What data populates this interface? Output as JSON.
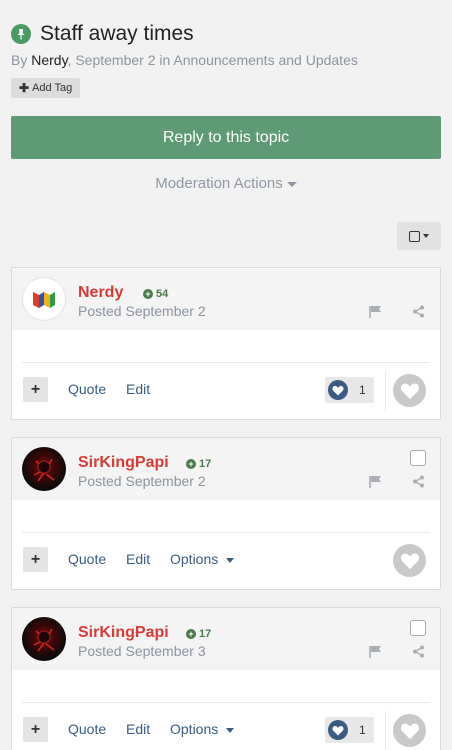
{
  "topic": {
    "title": "Staff away times",
    "byline_prefix": "By ",
    "author": "Nerdy",
    "byline_suffix": ", September 2 in Announcements and Updates",
    "add_tag": "Add Tag"
  },
  "reply_label": "Reply to this topic",
  "moderation_label": "Moderation Actions",
  "posts": [
    {
      "username": "Nerdy",
      "reputation": "54",
      "posted": "Posted September 2",
      "quote": "Quote",
      "edit": "Edit",
      "likes": "1"
    },
    {
      "username": "SirKingPapi",
      "reputation": "17",
      "posted": "Posted September 2",
      "quote": "Quote",
      "edit": "Edit",
      "options": "Options"
    },
    {
      "username": "SirKingPapi",
      "reputation": "17",
      "posted": "Posted September 3",
      "quote": "Quote",
      "edit": "Edit",
      "options": "Options",
      "likes": "1"
    }
  ],
  "colors": {
    "accent_green": "#5e9a74",
    "username_red": "#d83a38",
    "link_blue": "#3a5b82"
  },
  "icons": [
    "pin-icon",
    "flag-icon",
    "share-icon",
    "heart-icon",
    "plus-icon",
    "checkbox-icon"
  ]
}
